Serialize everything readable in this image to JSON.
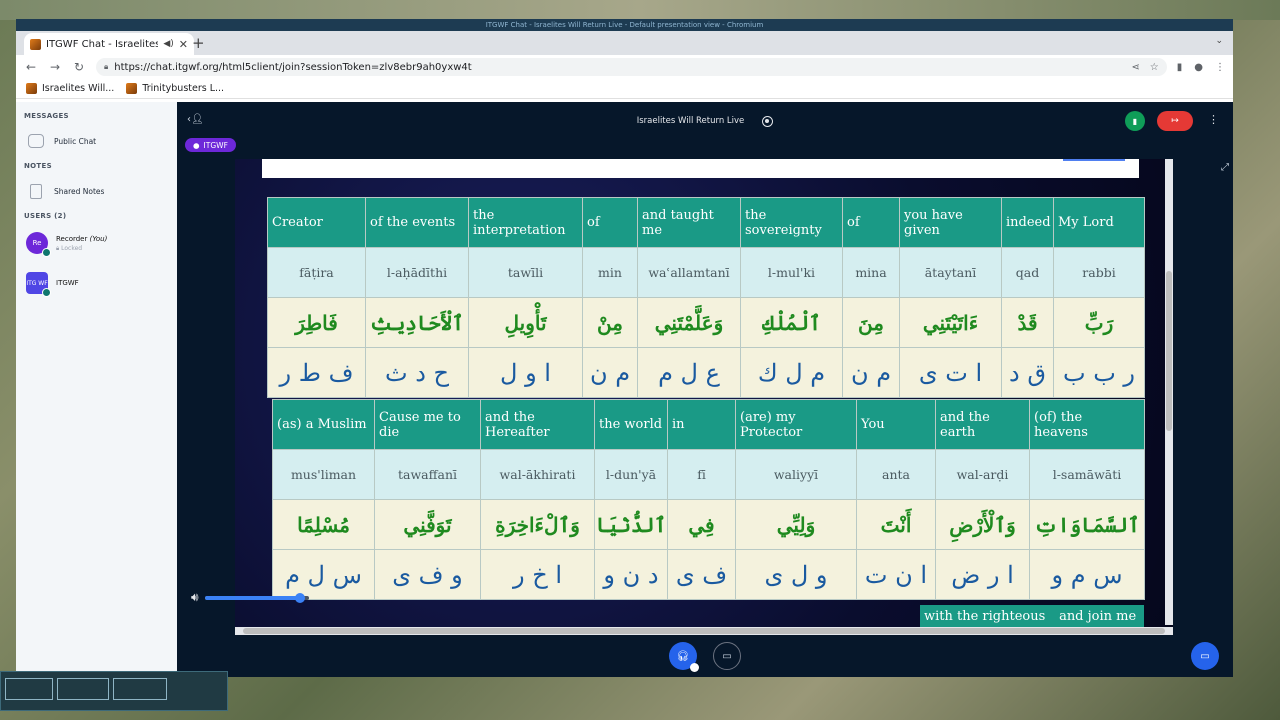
{
  "window_title": "ITGWF Chat - Israelites Will Return Live - Default presentation view - Chromium",
  "browser": {
    "tab_title": "ITGWF Chat - Israelites",
    "url": "https://chat.itgwf.org/html5client/join?sessionToken=zlv8ebr9ah0yxw4t",
    "bookmarks": [
      "Israelites Will...",
      "Trinitybusters L..."
    ]
  },
  "sidebar": {
    "messages_header": "MESSAGES",
    "public_chat": "Public Chat",
    "notes_header": "NOTES",
    "shared_notes": "Shared Notes",
    "users_header": "USERS (2)",
    "users": [
      {
        "initials": "Re",
        "name": "Recorder",
        "you": "(You)",
        "sub": "Locked"
      },
      {
        "initials": "ITG WF",
        "name": "ITGWF"
      }
    ]
  },
  "meeting": {
    "title": "Israelites Will Return Live",
    "talker": "ITGWF"
  },
  "table1": {
    "en": [
      "Creator",
      "of the events",
      "the interpretation",
      "of",
      "and taught me",
      "the sovereignty",
      "of",
      "you have given",
      "indeed",
      "My Lord"
    ],
    "tr": [
      "fāṭira",
      "l-aḥādīthi",
      "tawīli",
      "min",
      "waʿallamtanī",
      "l-mul'ki",
      "mina",
      "ātaytanī",
      "qad",
      "rabbi"
    ],
    "ar": [
      "فَاطِرَ",
      "ٱلْأَحَادِيثِ",
      "تَأْوِيلِ",
      "مِنْ",
      "وَعَلَّمْتَنِي",
      "ٱلْمُلْكِ",
      "مِنَ",
      "ءَاتَيْتَنِي",
      "قَدْ",
      "رَبِّ"
    ],
    "root": [
      "ف ط ر",
      "ح د ث",
      "ا و ل",
      "م ن",
      "ع ل م",
      "م ل ك",
      "م ن",
      "ا ت ى",
      "ق د",
      "ر ب ب"
    ]
  },
  "table2": {
    "en": [
      "(as) a Muslim",
      "Cause me to die",
      "and the Hereafter",
      "the world",
      "in",
      "(are) my Protector",
      "You",
      "and the earth",
      "(of) the heavens"
    ],
    "tr": [
      "mus'liman",
      "tawaffanī",
      "wal-ākhirati",
      "l-dun'yā",
      "fī",
      "waliyyī",
      "anta",
      "wal-arḍi",
      "l-samāwāti"
    ],
    "ar": [
      "مُسْلِمًا",
      "تَوَفَّنِي",
      "وَٱلْءَاخِرَةِ",
      "ٱلدُّنْيَا",
      "فِي",
      "وَلِيِّي",
      "أَنْتَ",
      "وَٱلْأَرْضِ",
      "ٱلسَّمَاوَاتِ"
    ],
    "root": [
      "س ل م",
      "و ف ى",
      "ا خ ر",
      "د ن و",
      "ف ى",
      "و ل ى",
      "ا ن ت",
      "ا ر ض",
      "س م و"
    ]
  },
  "table3": {
    "en": [
      "with the righteous",
      "and join me"
    ]
  },
  "volume": {
    "level": 0.92
  }
}
